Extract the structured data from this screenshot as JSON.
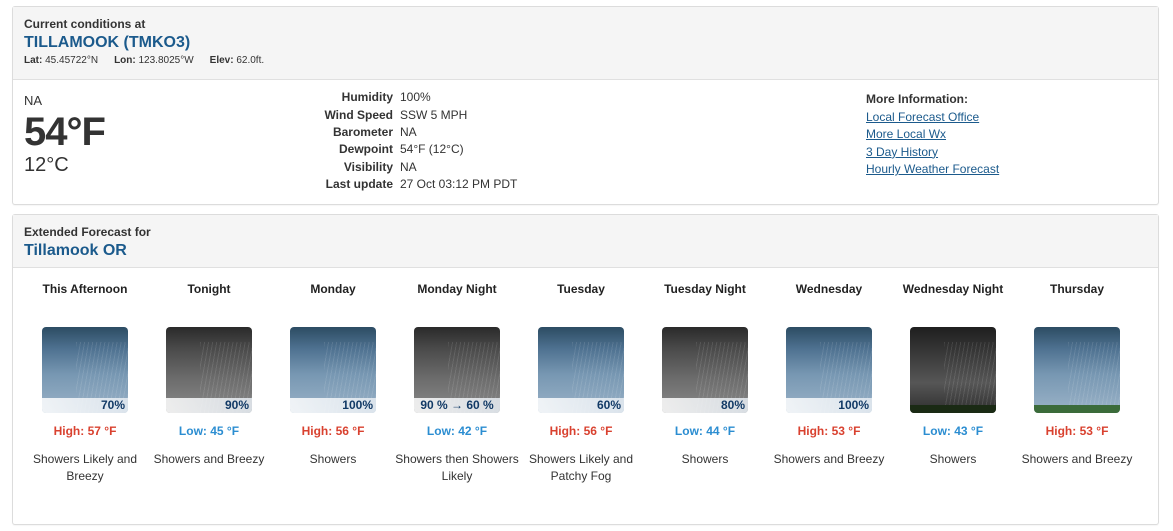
{
  "current": {
    "label": "Current conditions at",
    "station": "TILLAMOOK (TMKO3)",
    "lat_label": "Lat:",
    "lat": "45.45722°N",
    "lon_label": "Lon:",
    "lon": "123.8025°W",
    "elev_label": "Elev:",
    "elev": "62.0ft.",
    "summary": "NA",
    "temp_f": "54°F",
    "temp_c": "12°C",
    "details": [
      {
        "label": "Humidity",
        "value": "100%"
      },
      {
        "label": "Wind Speed",
        "value": "SSW 5 MPH"
      },
      {
        "label": "Barometer",
        "value": "NA"
      },
      {
        "label": "Dewpoint",
        "value": "54°F (12°C)"
      },
      {
        "label": "Visibility",
        "value": "NA"
      },
      {
        "label": "Last update",
        "value": "27 Oct 03:12 PM PDT"
      }
    ],
    "more_title": "More Information:",
    "links": [
      "Local Forecast Office",
      "More Local Wx",
      "3 Day History",
      "Hourly Weather Forecast"
    ]
  },
  "extended": {
    "label": "Extended Forecast for",
    "location": "Tillamook OR",
    "periods": [
      {
        "name": "This Afternoon",
        "pop": "70%",
        "temp": "High: 57 °F",
        "kind": "high",
        "desc": "Showers Likely and Breezy",
        "icon": "showers-day-icon"
      },
      {
        "name": "Tonight",
        "pop": "90%",
        "temp": "Low: 45 °F",
        "kind": "low",
        "desc": "Showers and Breezy",
        "icon": "showers-night-icon"
      },
      {
        "name": "Monday",
        "pop": "100%",
        "temp": "High: 56 °F",
        "kind": "high",
        "desc": "Showers",
        "icon": "showers-day-icon"
      },
      {
        "name": "Monday Night",
        "pop": "90 % → 60 %",
        "temp": "Low: 42 °F",
        "kind": "low",
        "desc": "Showers then Showers Likely",
        "icon": "showers-night-icon"
      },
      {
        "name": "Tuesday",
        "pop": "60%",
        "temp": "High: 56 °F",
        "kind": "high",
        "desc": "Showers Likely and Patchy Fog",
        "icon": "showers-day-icon"
      },
      {
        "name": "Tuesday Night",
        "pop": "80%",
        "temp": "Low: 44 °F",
        "kind": "low",
        "desc": "Showers",
        "icon": "showers-night-icon"
      },
      {
        "name": "Wednesday",
        "pop": "100%",
        "temp": "High: 53 °F",
        "kind": "high",
        "desc": "Showers and Breezy",
        "icon": "showers-day-icon"
      },
      {
        "name": "Wednesday Night",
        "pop": "",
        "temp": "Low: 43 °F",
        "kind": "low",
        "desc": "Showers",
        "icon": "rain-night-icon"
      },
      {
        "name": "Thursday",
        "pop": "",
        "temp": "High: 53 °F",
        "kind": "high",
        "desc": "Showers and Breezy",
        "icon": "rain-day-icon"
      }
    ]
  },
  "colors": {
    "title_blue": "#1b5a8c",
    "high_red": "#d9412f",
    "low_blue": "#2b8dd1"
  }
}
